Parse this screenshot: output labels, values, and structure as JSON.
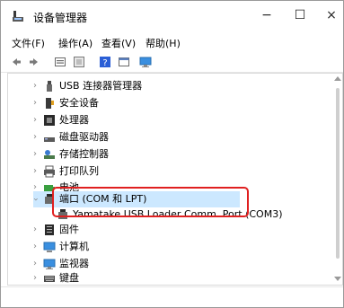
{
  "window": {
    "title": "设备管理器",
    "controls": {
      "minimize": "−",
      "maximize": "☐",
      "close": "×"
    }
  },
  "menu": [
    {
      "label": "文件(F)"
    },
    {
      "label": "操作(A)"
    },
    {
      "label": "查看(V)"
    },
    {
      "label": "帮助(H)"
    }
  ],
  "toolbar": [
    "back-icon",
    "forward-icon",
    "properties-icon",
    "grid-icon",
    "help-icon",
    "view-icon",
    "monitor-icon"
  ],
  "tree": [
    {
      "label": "USB 连接器管理器",
      "expanded": false,
      "icon": "usb-connector-icon"
    },
    {
      "label": "安全设备",
      "expanded": false,
      "icon": "security-device-icon"
    },
    {
      "label": "处理器",
      "expanded": false,
      "icon": "processor-icon"
    },
    {
      "label": "磁盘驱动器",
      "expanded": false,
      "icon": "disk-drive-icon"
    },
    {
      "label": "存储控制器",
      "expanded": false,
      "icon": "storage-controller-icon"
    },
    {
      "label": "打印队列",
      "expanded": false,
      "icon": "print-queue-icon"
    },
    {
      "label": "电池",
      "expanded": false,
      "icon": "battery-icon"
    },
    {
      "label": "端口 (COM 和 LPT)",
      "expanded": true,
      "selected": true,
      "icon": "port-icon"
    },
    {
      "label": "Yamatake USB Loader Comm. Port (COM3)",
      "child": true,
      "icon": "comm-port-icon"
    },
    {
      "label": "固件",
      "expanded": false,
      "icon": "firmware-icon"
    },
    {
      "label": "计算机",
      "expanded": false,
      "icon": "computer-icon"
    },
    {
      "label": "监视器",
      "expanded": false,
      "icon": "monitor-icon"
    },
    {
      "label": "键盘",
      "expanded": false,
      "icon": "keyboard-icon"
    }
  ],
  "colors": {
    "selection": "#cce8ff",
    "annotation": "#e02020"
  }
}
